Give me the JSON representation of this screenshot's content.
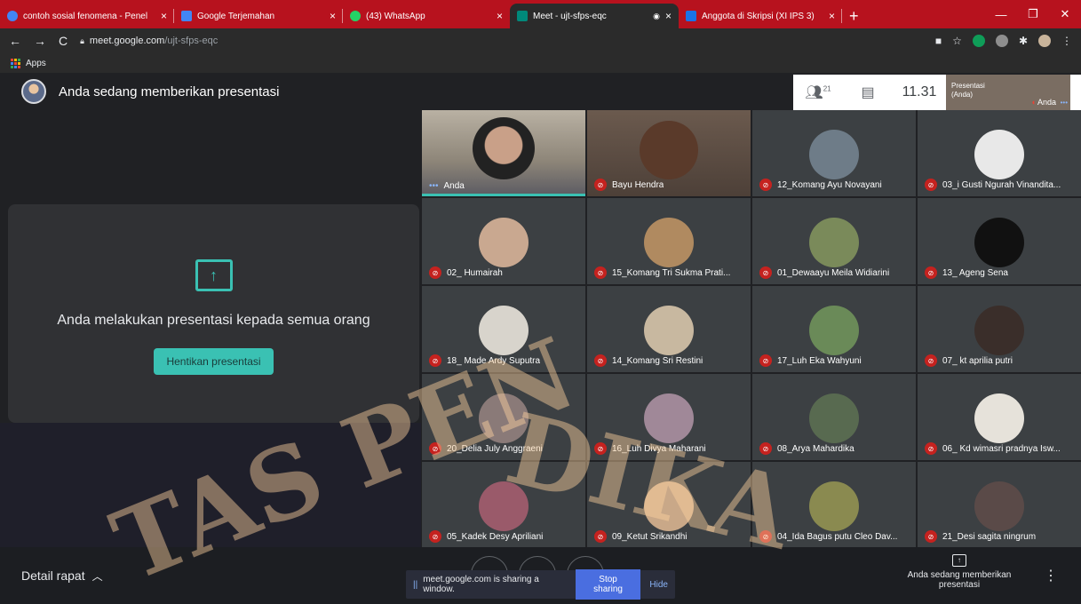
{
  "browser": {
    "tabs": [
      {
        "title": "contoh sosial fenomena - Penel",
        "color": "#4285f4"
      },
      {
        "title": "Google Terjemahan",
        "color": "#4285f4"
      },
      {
        "title": "(43) WhatsApp",
        "color": "#25d366"
      },
      {
        "title": "Meet - ujt-sfps-eqc",
        "color": "#00897b"
      },
      {
        "title": "Anggota di Skripsi (XI IPS 3)",
        "color": "#1a73e8"
      }
    ],
    "new_tab": "+",
    "url_host": "meet.google.com",
    "url_path": "/ujt-sfps-eqc",
    "bookmark_apps": "Apps"
  },
  "meet": {
    "presenter_title": "Anda sedang memberikan presentasi",
    "participant_count": "21",
    "clock": "11.31",
    "self_presenting_label_1": "Presentasi",
    "self_presenting_label_2": "(Anda)",
    "self_name": "Anda",
    "present_message": "Anda melakukan presentasi kepada semua orang",
    "stop_presenting": "Hentikan presentasi",
    "participants": [
      "Anda",
      "Bayu Hendra",
      "12_Komang Ayu Novayani",
      "03_i Gusti Ngurah Vinandita...",
      "02_ Humairah",
      "15_Komang Tri Sukma Prati...",
      "01_Dewaayu Meila Widiarini",
      "13_ Ageng Sena",
      "18_ Made Ardy Suputra",
      "14_Komang Sri Restini",
      "17_Luh Eka Wahyuni",
      "07_ kt aprilia putri",
      "20_Delia July Anggraeni",
      "16_Luh Divya Maharani",
      "08_Arya Mahardika",
      "06_ Kd wimasri pradnya Isw...",
      "05_Kadek Desy Apriliani",
      "09_Ketut Srikandhi",
      "04_Ida Bagus putu Cleo Dav...",
      "21_Desi sagita ningrum"
    ],
    "meeting_details": "Detail rapat",
    "share_notice": "meet.google.com is sharing a window.",
    "stop_sharing": "Stop sharing",
    "hide": "Hide",
    "presenting_status": "Anda sedang memberikan presentasi"
  },
  "watermark": {
    "word1": "TAS PEN",
    "word2": "DIKA"
  },
  "colors": {
    "accent": "#3ac1b3",
    "tab_strip": "#b7121e",
    "muted": "#c5221f"
  }
}
